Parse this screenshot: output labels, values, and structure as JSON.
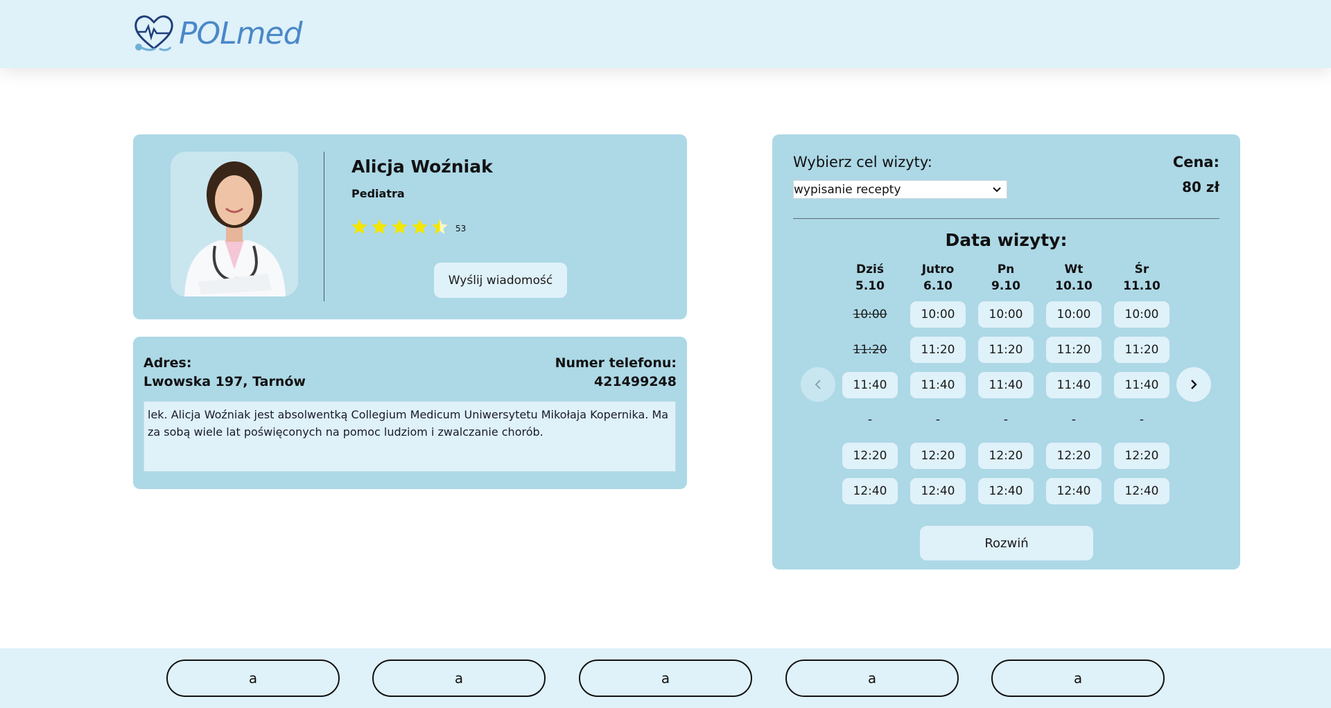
{
  "header": {
    "logo_text": "POLmed"
  },
  "doctor": {
    "name": "Alicja Woźniak",
    "specialty": "Pediatra",
    "rating": 4.5,
    "rating_count": "53",
    "message_button": "Wyślij wiadomość"
  },
  "info": {
    "address_label": "Adres:",
    "address": "Lwowska 197, Tarnów",
    "phone_label": "Numer telefonu:",
    "phone": "421499248",
    "bio": "lek. Alicja Woźniak jest absolwentką Collegium Medicum Uniwersytetu Mikołaja Kopernika. Ma za sobą wiele lat poświęconych na pomoc ludziom i zwalczanie chorób."
  },
  "booking": {
    "purpose_label": "Wybierz cel wizyty:",
    "purpose_selected": "wypisanie recepty",
    "price_label": "Cena:",
    "price": "80 zł",
    "date_title": "Data wizyty:",
    "days": [
      {
        "name": "Dziś",
        "date": "5.10",
        "slots": [
          {
            "time": "10:00",
            "taken": true
          },
          {
            "time": "11:20",
            "taken": true
          },
          {
            "time": "11:40",
            "taken": false
          },
          {
            "time": "-",
            "sep": true
          },
          {
            "time": "12:20",
            "taken": false
          },
          {
            "time": "12:40",
            "taken": false
          }
        ]
      },
      {
        "name": "Jutro",
        "date": "6.10",
        "slots": [
          {
            "time": "10:00",
            "taken": false
          },
          {
            "time": "11:20",
            "taken": false
          },
          {
            "time": "11:40",
            "taken": false
          },
          {
            "time": "-",
            "sep": true
          },
          {
            "time": "12:20",
            "taken": false
          },
          {
            "time": "12:40",
            "taken": false
          }
        ]
      },
      {
        "name": "Pn",
        "date": "9.10",
        "slots": [
          {
            "time": "10:00",
            "taken": false
          },
          {
            "time": "11:20",
            "taken": false
          },
          {
            "time": "11:40",
            "taken": false
          },
          {
            "time": "-",
            "sep": true
          },
          {
            "time": "12:20",
            "taken": false
          },
          {
            "time": "12:40",
            "taken": false
          }
        ]
      },
      {
        "name": "Wt",
        "date": "10.10",
        "slots": [
          {
            "time": "10:00",
            "taken": false
          },
          {
            "time": "11:20",
            "taken": false
          },
          {
            "time": "11:40",
            "taken": false
          },
          {
            "time": "-",
            "sep": true
          },
          {
            "time": "12:20",
            "taken": false
          },
          {
            "time": "12:40",
            "taken": false
          }
        ]
      },
      {
        "name": "Śr",
        "date": "11.10",
        "slots": [
          {
            "time": "10:00",
            "taken": false
          },
          {
            "time": "11:20",
            "taken": false
          },
          {
            "time": "11:40",
            "taken": false
          },
          {
            "time": "-",
            "sep": true
          },
          {
            "time": "12:20",
            "taken": false
          },
          {
            "time": "12:40",
            "taken": false
          }
        ]
      }
    ],
    "expand_button": "Rozwiń"
  },
  "footer": {
    "buttons": [
      "a",
      "a",
      "a",
      "a",
      "a"
    ]
  },
  "colors": {
    "card": "#add8e6",
    "light": "#dff1f9",
    "logo": "#4a88c8",
    "star": "#f2e600"
  }
}
